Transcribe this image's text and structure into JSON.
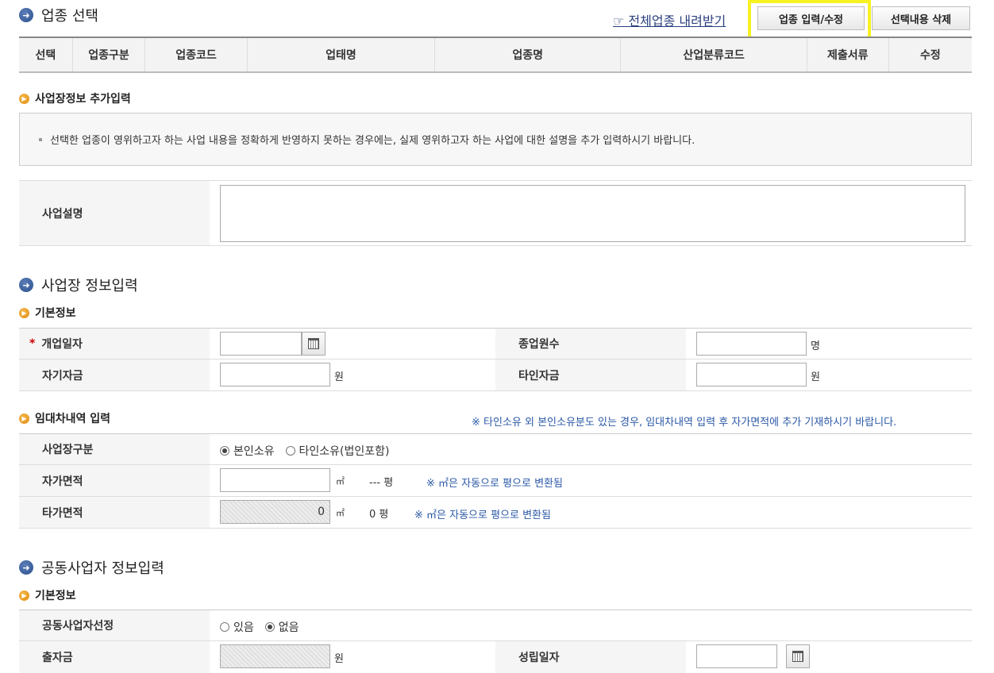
{
  "section1": {
    "title": "업종 선택",
    "download_link": "☞ 전체업종 내려받기",
    "btn_edit": "업종 입력/수정",
    "btn_delete": "선택내용 삭제",
    "columns": [
      "선택",
      "업종구분",
      "업종코드",
      "업태명",
      "업종명",
      "산업분류코드",
      "제출서류",
      "수정"
    ]
  },
  "extra": {
    "title": "사업장정보 추가입력",
    "note": "선택한 업종이 영위하고자 하는 사업 내용을 정확하게 반영하지 못하는 경우에는, 실제 영위하고자 하는 사업에 대한 설명을 추가 입력하시기 바랍니다.",
    "desc_label": "사업설명"
  },
  "section2": {
    "title": "사업장 정보입력",
    "basic_title": "기본정보",
    "open_date": "개업일자",
    "employees": "종업원수",
    "emp_unit": "명",
    "own_fund": "자기자금",
    "own_unit": "원",
    "other_fund": "타인자금",
    "other_unit": "원",
    "lease_title": "임대차내역 입력",
    "lease_note": "※ 타인소유 외 본인소유분도 있는 경우, 임대차내역 입력 후 자가면적에 추가 기재하시기 바랍니다.",
    "site_type": "사업장구분",
    "opt_own": "본인소유",
    "opt_other": "타인소유(법인포함)",
    "own_area": "자가면적",
    "area_unit": "㎡",
    "own_pyeong": "--- 평",
    "area_note": "※ ㎡은 자동으로 평으로 변환됨",
    "other_area": "타가면적",
    "other_area_value": "0",
    "other_pyeong": "0 평",
    "area_note2": "※ ㎡은 자동으로 평으로 변환됨"
  },
  "section3": {
    "title": "공동사업자 정보입력",
    "basic_title": "기본정보",
    "joint_select": "공동사업자선정",
    "opt_yes": "있음",
    "opt_no": "없음",
    "contribution": "출자금",
    "contrib_unit": "원",
    "est_date": "성립일자"
  },
  "colors": {
    "highlight": "#f7f123",
    "link": "#2b3f7e",
    "note_blue": "#2a58a6"
  }
}
